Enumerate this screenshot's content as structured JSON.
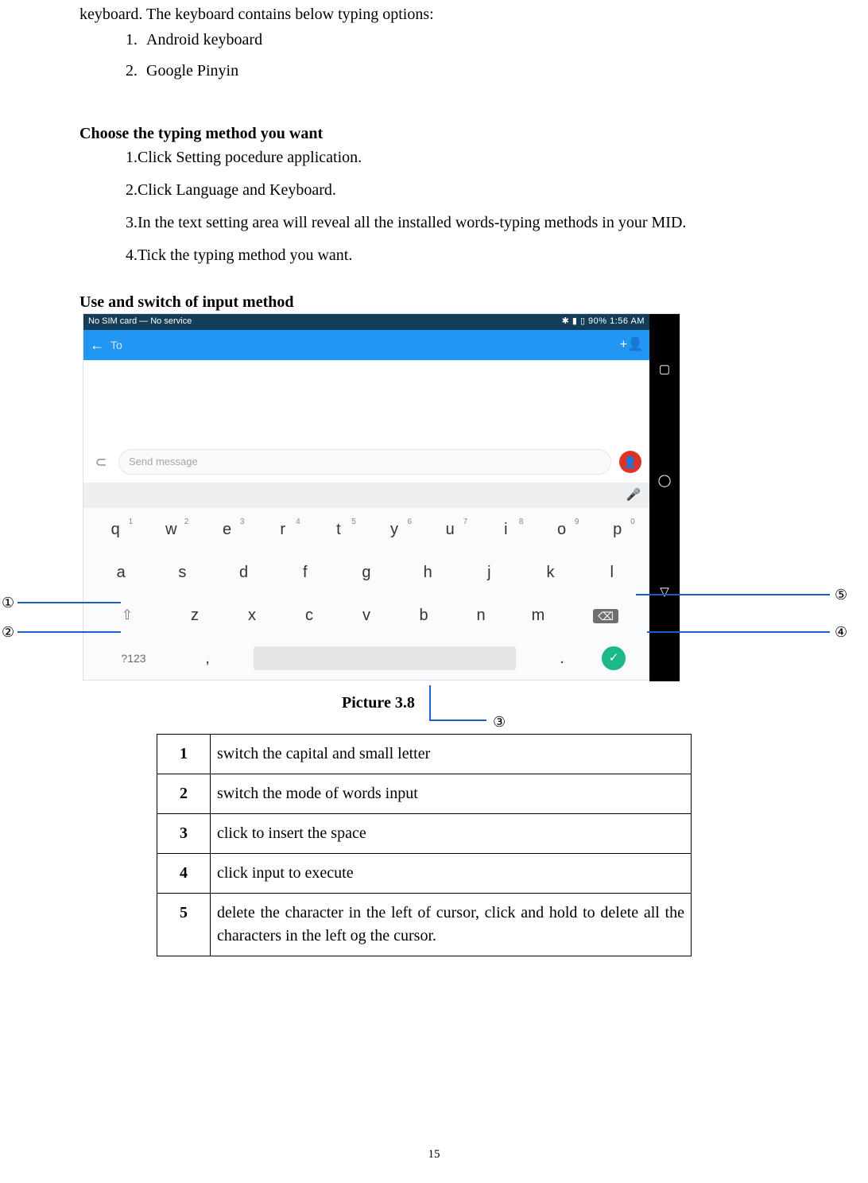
{
  "intro_line": "keyboard. The keyboard contains below typing options:",
  "keyboard_options": [
    "Android keyboard",
    "Google Pinyin"
  ],
  "heading_choose": "Choose the typing method you want",
  "choose_steps": [
    "Click Setting pocedure application.",
    "Click Language and Keyboard.",
    "In the text setting area will reveal all the installed words-typing methods in your MID.",
    "Tick the typing method you want."
  ],
  "heading_use": "Use and switch of input method",
  "screenshot": {
    "status_left": "No SIM card — No service",
    "status_icons": "▭  ◣",
    "status_right": "✱ ▮ ▯ 90% 1:56 AM",
    "to_placeholder": "To",
    "message_placeholder": "Send message",
    "nav": {
      "square": "▢",
      "circle": "◯",
      "triangle": "▽"
    },
    "row1": [
      {
        "k": "q",
        "n": "1"
      },
      {
        "k": "w",
        "n": "2"
      },
      {
        "k": "e",
        "n": "3"
      },
      {
        "k": "r",
        "n": "4"
      },
      {
        "k": "t",
        "n": "5"
      },
      {
        "k": "y",
        "n": "6"
      },
      {
        "k": "u",
        "n": "7"
      },
      {
        "k": "i",
        "n": "8"
      },
      {
        "k": "o",
        "n": "9"
      },
      {
        "k": "p",
        "n": "0"
      }
    ],
    "row2": [
      "a",
      "s",
      "d",
      "f",
      "g",
      "h",
      "j",
      "k",
      "l"
    ],
    "row3": [
      "z",
      "x",
      "c",
      "v",
      "b",
      "n",
      "m"
    ],
    "shift_glyph": "⇧",
    "del_glyph": "⌫",
    "sym_label": "?123",
    "comma": ",",
    "period": ".",
    "enter_glyph": "✓",
    "mic_glyph": "🎤",
    "back_glyph": "←",
    "add_contact_glyph": "+👤",
    "attach_glyph": "⊂",
    "send_glyph": "👤"
  },
  "callouts": {
    "c1": "①",
    "c2": "②",
    "c3": "③",
    "c4": "④",
    "c5": "⑤"
  },
  "caption": "Picture 3.8",
  "legend": [
    {
      "n": "1",
      "t": "switch the capital and small letter"
    },
    {
      "n": "2",
      "t": "switch the mode of words input"
    },
    {
      "n": "3",
      "t": "click to insert the space"
    },
    {
      "n": "4",
      "t": "click input to execute"
    },
    {
      "n": "5",
      "t": "delete the character in the left of cursor, click and hold to delete all the characters in the left og the cursor."
    }
  ],
  "page_number": "15"
}
